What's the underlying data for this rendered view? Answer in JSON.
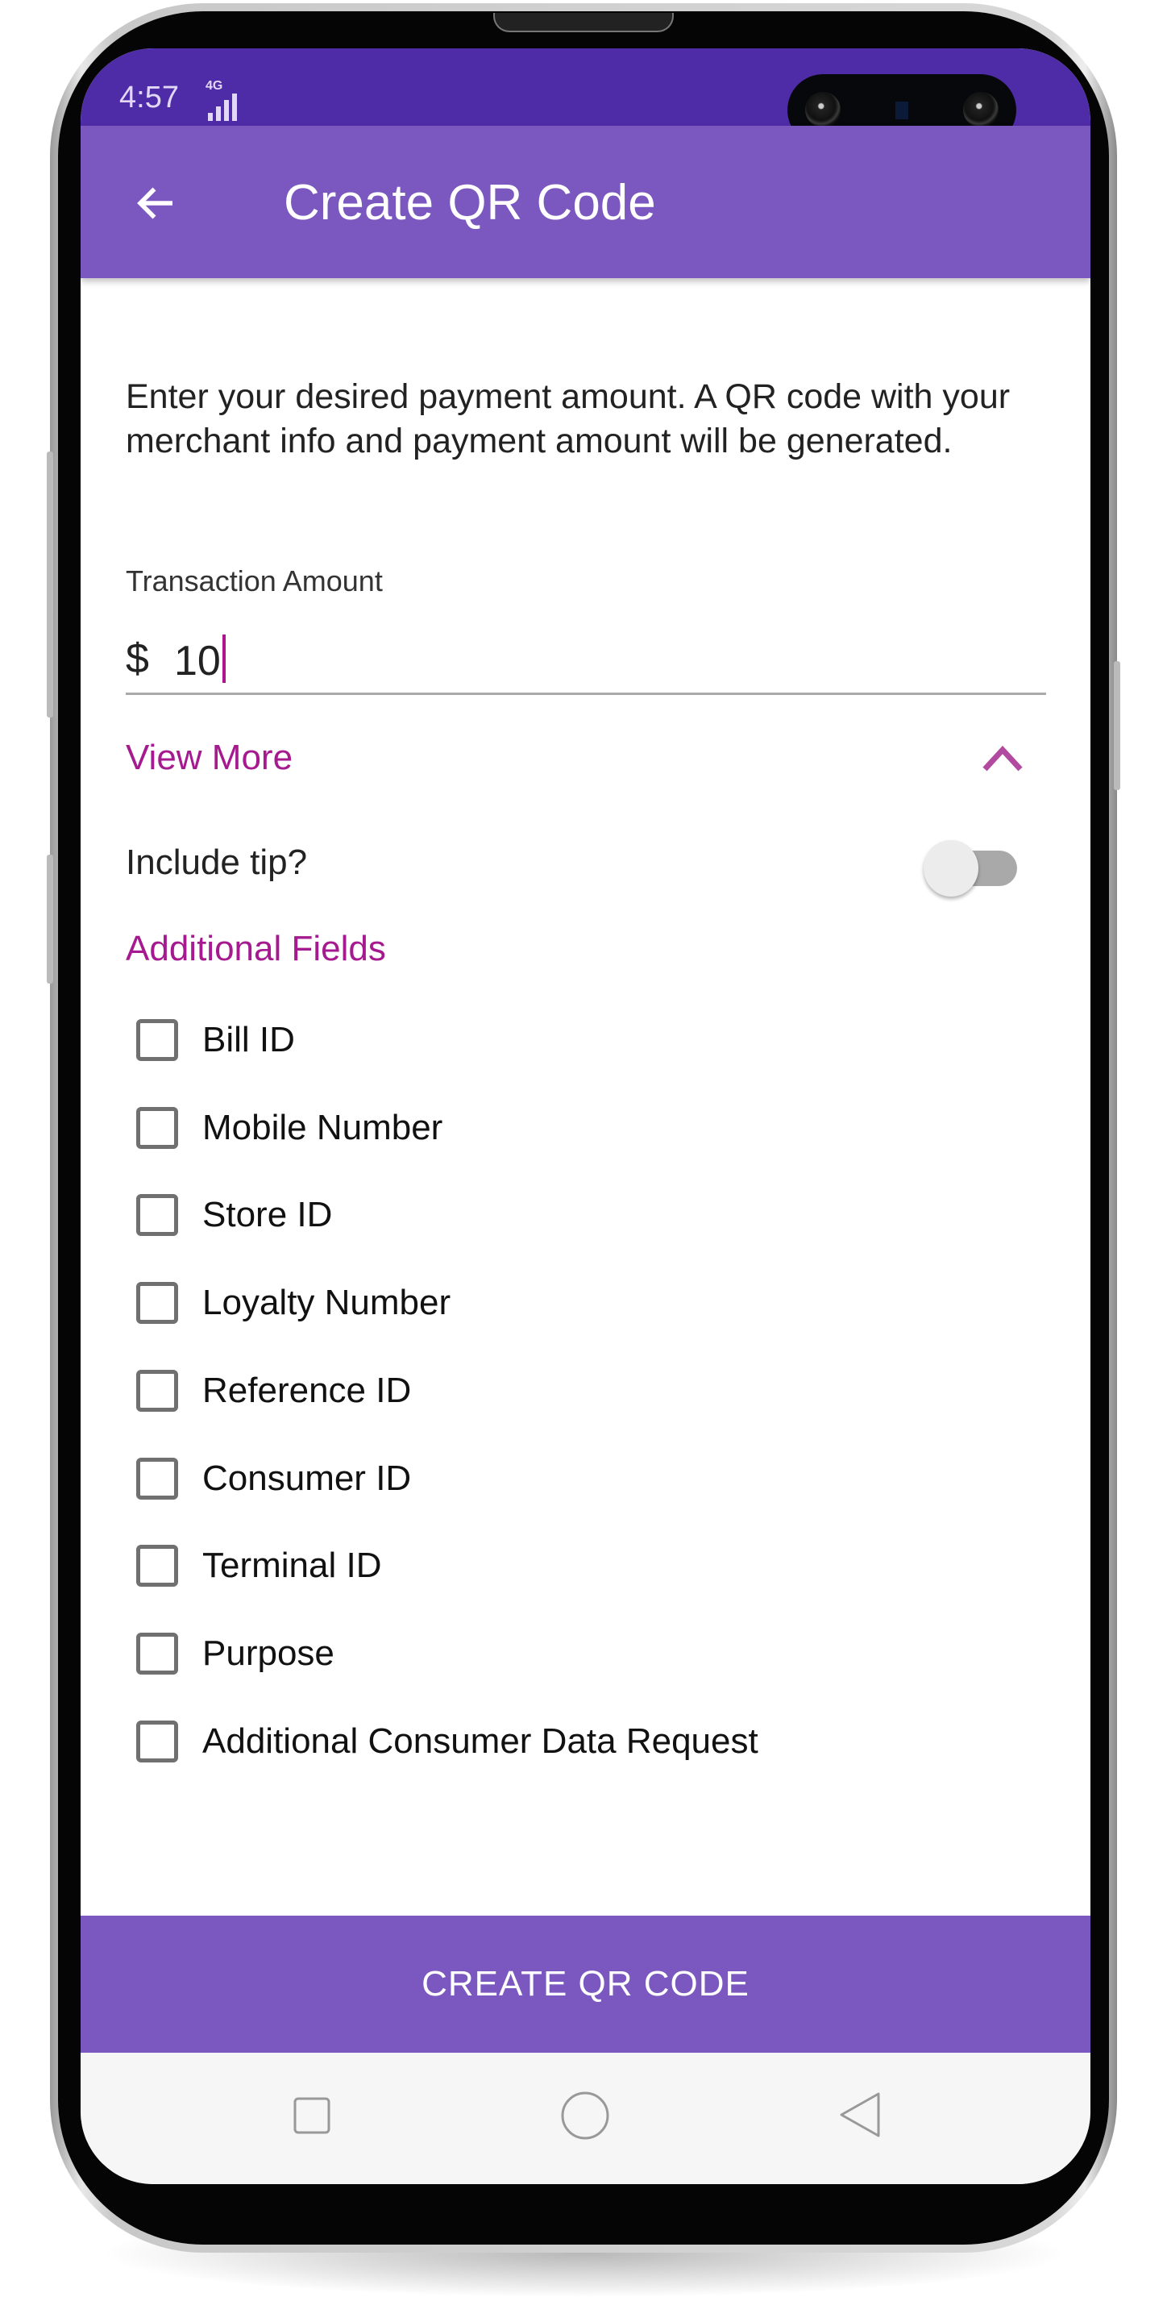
{
  "status_bar": {
    "time": "4:57",
    "network": "4G"
  },
  "app_bar": {
    "title": "Create QR Code",
    "back_icon": "arrow-left-icon"
  },
  "form": {
    "description": "Enter your desired payment amount. A QR code with your merchant info and payment amount will be generated.",
    "amount_label": "Transaction Amount",
    "currency_symbol": "$",
    "amount_value": "10",
    "view_more_label": "View More",
    "view_more_expanded": true,
    "include_tip_label": "Include tip?",
    "include_tip_on": false,
    "additional_fields_title": "Additional Fields",
    "additional_fields": [
      {
        "label": "Bill ID",
        "checked": false
      },
      {
        "label": "Mobile Number",
        "checked": false
      },
      {
        "label": "Store ID",
        "checked": false
      },
      {
        "label": "Loyalty Number",
        "checked": false
      },
      {
        "label": "Reference ID",
        "checked": false
      },
      {
        "label": "Consumer ID",
        "checked": false
      },
      {
        "label": "Terminal ID",
        "checked": false
      },
      {
        "label": "Purpose",
        "checked": false
      },
      {
        "label": "Additional Consumer Data Request",
        "checked": false
      }
    ]
  },
  "create_button": {
    "label": "CREATE QR CODE"
  },
  "colors": {
    "status_bar": "#4f2ca7",
    "primary": "#7b57c0",
    "accent": "#a51a8f"
  },
  "nav_bar": {
    "icons": [
      "recents-square-icon",
      "home-circle-icon",
      "back-triangle-icon"
    ]
  }
}
